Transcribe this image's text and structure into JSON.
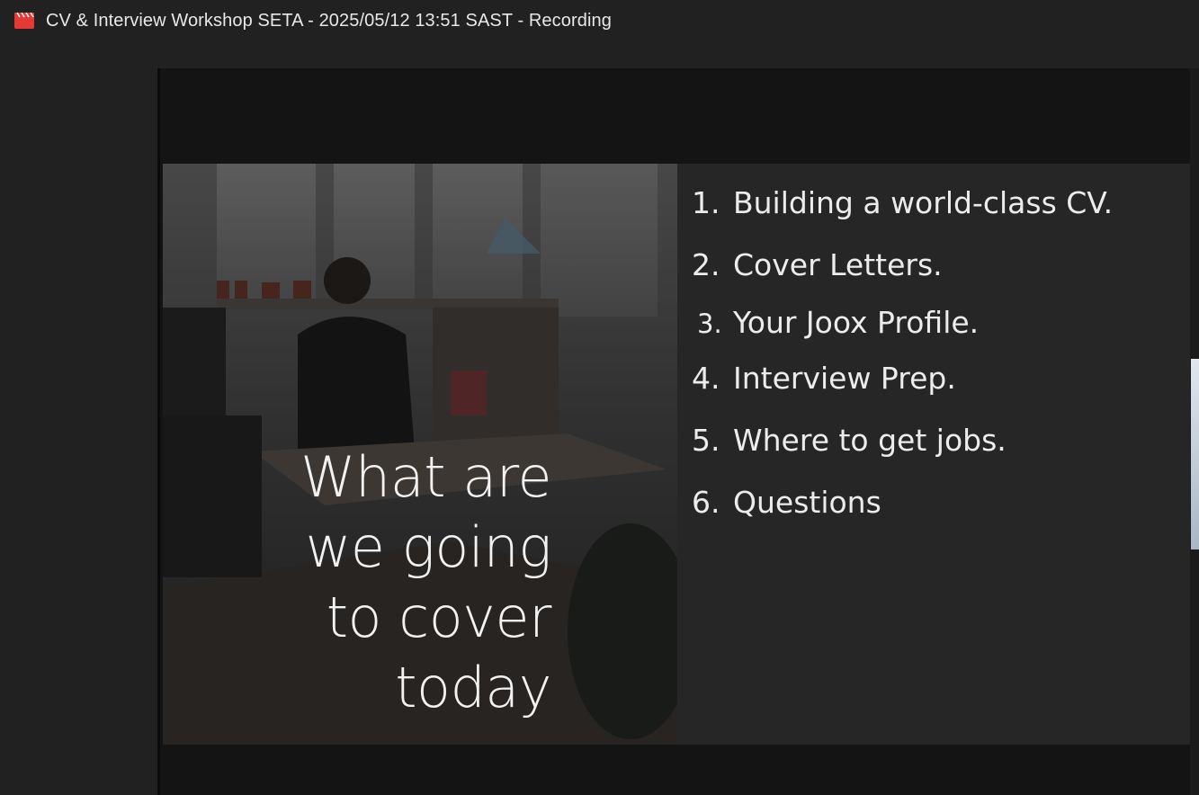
{
  "window": {
    "title": "CV & Interview Workshop SETA - 2025/05/12 13:51 SAST - Recording",
    "icon": "video-file-icon",
    "icon_color": "#e53935"
  },
  "slide": {
    "headline": "What are\nwe going\nto cover\ntoday",
    "agenda": [
      {
        "number": "1.",
        "text": "Building a world-class CV."
      },
      {
        "number": "2.",
        "text": "Cover Letters."
      },
      {
        "number": "3.",
        "text": "Your Joox Profile."
      },
      {
        "number": "4.",
        "text": "Interview Prep."
      },
      {
        "number": "5.",
        "text": "Where to get jobs."
      },
      {
        "number": "6.",
        "text": "Questions"
      }
    ]
  },
  "colors": {
    "background": "#212121",
    "video_area": "#141414",
    "slide_panel": "#262626",
    "text": "#ececec"
  }
}
